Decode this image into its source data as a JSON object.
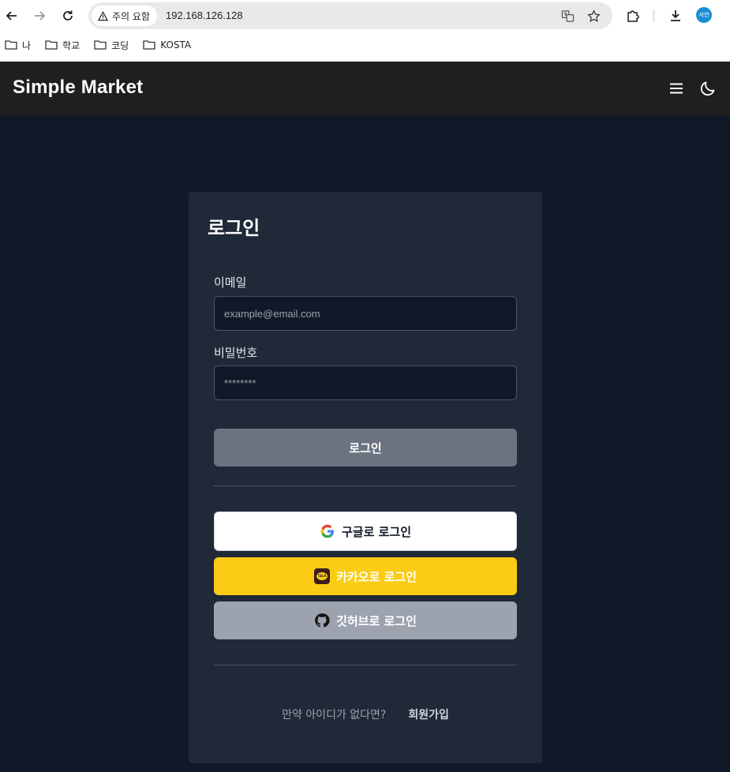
{
  "browser": {
    "security_label": "주의 요함",
    "url": "192.168.126.128",
    "profile_initials": "서연",
    "bookmarks": [
      {
        "label": "나"
      },
      {
        "label": "학교"
      },
      {
        "label": "코딩"
      },
      {
        "label": "KOSTA"
      }
    ]
  },
  "header": {
    "brand": "Simple Market"
  },
  "login": {
    "title": "로그인",
    "email_label": "이메일",
    "email_placeholder": "example@email.com",
    "password_label": "비밀번호",
    "password_placeholder": "********",
    "submit_label": "로그인",
    "google_label": "구글로 로그인",
    "kakao_label": "카카오로 로그인",
    "github_label": "깃허브로 로그인",
    "signup_prompt": "만약 아이디가 없다면?",
    "signup_link": "회원가입"
  },
  "colors": {
    "page_bg": "#111827",
    "card_bg": "#1f2937",
    "header_bg": "#1f1f1f",
    "kakao_yellow": "#facc15",
    "github_gray": "#9ca3af",
    "login_btn": "#6b7280"
  },
  "icons": [
    "back-icon",
    "forward-icon",
    "reload-icon",
    "warning-icon",
    "translate-icon",
    "star-icon",
    "extensions-icon",
    "download-icon",
    "folder-icon",
    "menu-icon",
    "moon-icon",
    "google-icon",
    "kakao-icon",
    "github-icon"
  ]
}
